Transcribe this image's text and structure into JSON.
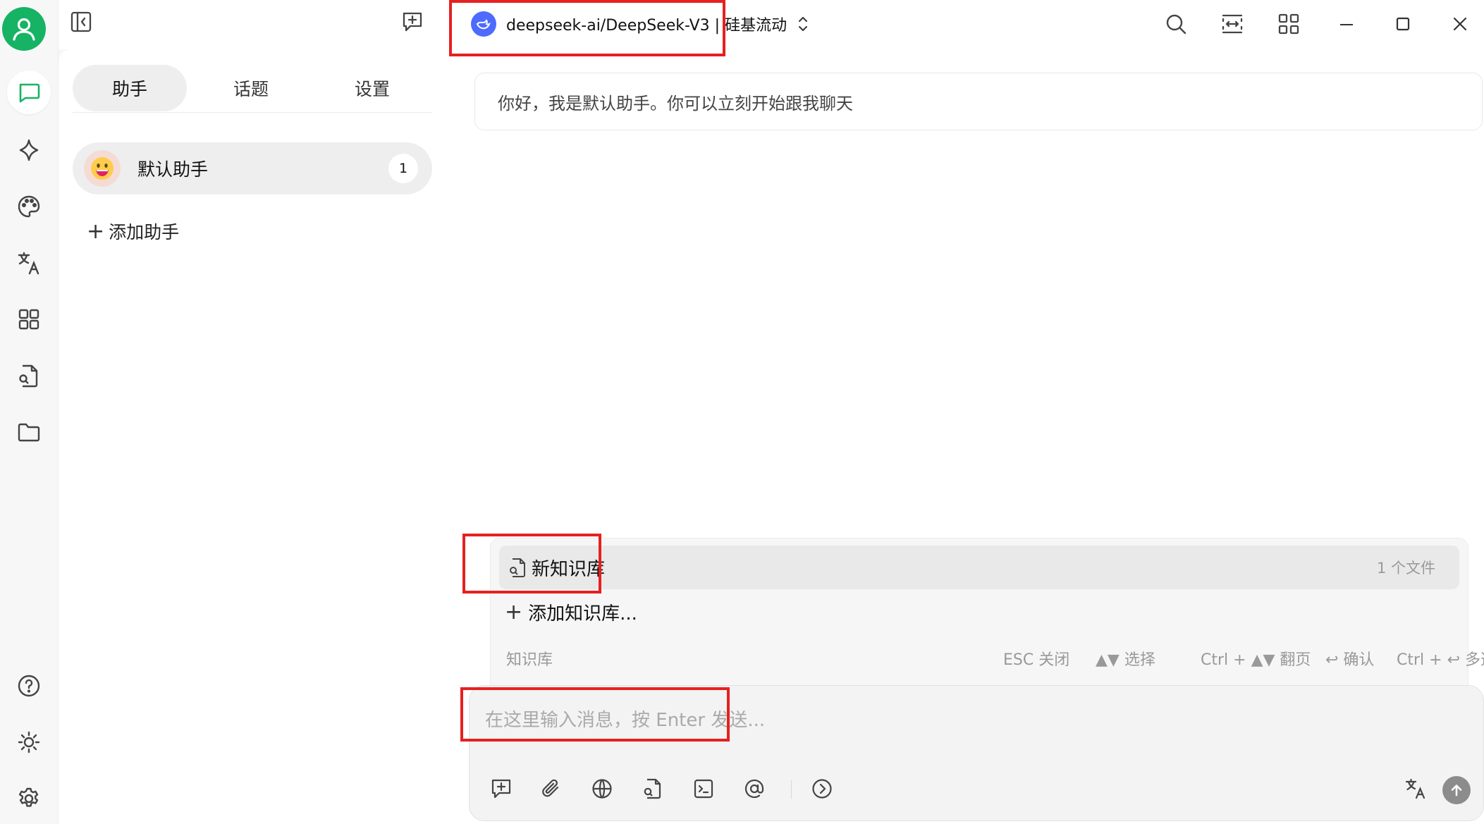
{
  "rail": {
    "items": [
      {
        "name": "chat",
        "icon": "chat-bubble-icon",
        "active": true
      },
      {
        "name": "agents",
        "icon": "sparkle-icon"
      },
      {
        "name": "paint",
        "icon": "palette-icon"
      },
      {
        "name": "translate",
        "icon": "translate-icon"
      },
      {
        "name": "apps",
        "icon": "grid-icon"
      },
      {
        "name": "knowledge",
        "icon": "file-search-icon"
      },
      {
        "name": "files",
        "icon": "folder-icon"
      }
    ],
    "bottom": [
      {
        "name": "help",
        "icon": "help-circle-icon"
      },
      {
        "name": "theme",
        "icon": "brightness-icon"
      },
      {
        "name": "settings",
        "icon": "gear-icon"
      }
    ],
    "accent_color": "#16b364"
  },
  "sidebar": {
    "tabs": [
      {
        "label": "助手",
        "active": true
      },
      {
        "label": "话题"
      },
      {
        "label": "设置"
      }
    ],
    "assistants": [
      {
        "name": "默认助手",
        "count": "1"
      }
    ],
    "add_assistant_label": "添加助手"
  },
  "header": {
    "model_label": "deepseek-ai/DeepSeek-V3 | 硅基流动",
    "model_logo_color": "#4d6bfe"
  },
  "chat": {
    "welcome_message": "你好，我是默认助手。你可以立刻开始跟我聊天"
  },
  "knowledge_popup": {
    "items": [
      {
        "name": "新知识库",
        "count": "1 个文件"
      }
    ],
    "add_label": "添加知识库...",
    "footer": {
      "title": "知识库",
      "esc": "ESC 关闭",
      "select": "▲▼ 选择",
      "page": "Ctrl + ▲▼ 翻页",
      "confirm": "↩ 确认",
      "multi": "Ctrl + ↩ 多选"
    }
  },
  "input": {
    "placeholder": "在这里输入消息，按 Enter 发送...",
    "value": ""
  },
  "highlight_color": "#e62020"
}
